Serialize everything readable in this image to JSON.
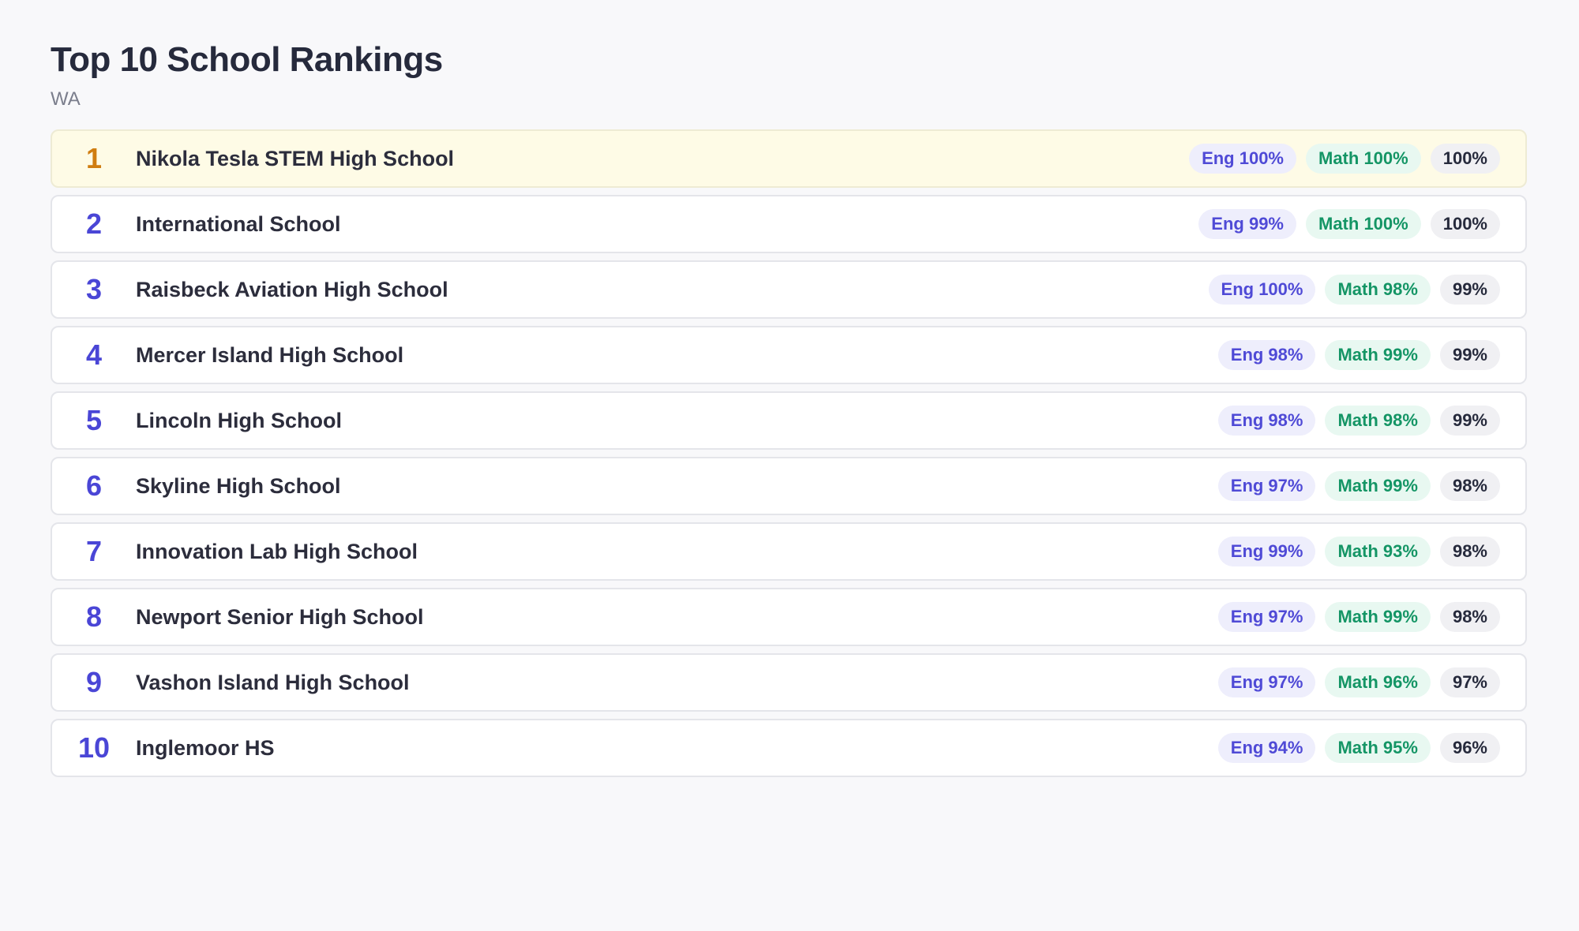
{
  "header": {
    "title": "Top 10 School Rankings",
    "subtitle": "WA"
  },
  "schools": [
    {
      "rank": "1",
      "name": "Nikola Tesla STEM High School",
      "eng": "Eng 100%",
      "math": "Math 100%",
      "total": "100%"
    },
    {
      "rank": "2",
      "name": "International School",
      "eng": "Eng 99%",
      "math": "Math 100%",
      "total": "100%"
    },
    {
      "rank": "3",
      "name": "Raisbeck Aviation High School",
      "eng": "Eng 100%",
      "math": "Math 98%",
      "total": "99%"
    },
    {
      "rank": "4",
      "name": "Mercer Island High School",
      "eng": "Eng 98%",
      "math": "Math 99%",
      "total": "99%"
    },
    {
      "rank": "5",
      "name": "Lincoln High School",
      "eng": "Eng 98%",
      "math": "Math 98%",
      "total": "99%"
    },
    {
      "rank": "6",
      "name": "Skyline High School",
      "eng": "Eng 97%",
      "math": "Math 99%",
      "total": "98%"
    },
    {
      "rank": "7",
      "name": "Innovation Lab High School",
      "eng": "Eng 99%",
      "math": "Math 93%",
      "total": "98%"
    },
    {
      "rank": "8",
      "name": "Newport Senior High School",
      "eng": "Eng 97%",
      "math": "Math 99%",
      "total": "98%"
    },
    {
      "rank": "9",
      "name": "Vashon Island High School",
      "eng": "Eng 97%",
      "math": "Math 96%",
      "total": "97%"
    },
    {
      "rank": "10",
      "name": "Inglemoor HS",
      "eng": "Eng 94%",
      "math": "Math 95%",
      "total": "96%"
    }
  ],
  "colors": {
    "rank_default": "#4a46d6",
    "rank_first": "#d07d10",
    "eng_badge": "#4f4ad6",
    "math_badge": "#149565"
  }
}
